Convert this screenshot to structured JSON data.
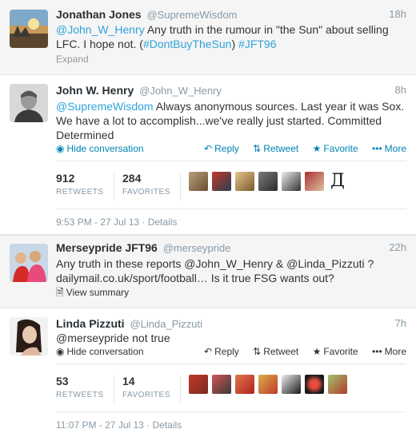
{
  "tweets": [
    {
      "fullname": "Jonathan Jones",
      "username": "@SupremeWisdom",
      "time": "18h",
      "text_parts": {
        "mention": "@John_W_Henry",
        "body1": " Any truth in the rumour in \"the Sun\" about selling LFC. I hope not. (",
        "hashtag1": "#DontBuyTheSun",
        "body2": ") ",
        "hashtag2": "#JFT96"
      },
      "expand": "Expand"
    },
    {
      "fullname": "John W. Henry",
      "username": "@John_W_Henry",
      "time": "8h",
      "text_parts": {
        "mention": "@SupremeWisdom",
        "body": " Always anonymous sources. Last year it was Sox. We have a lot to accomplish...we've really just started. Committed Determined"
      },
      "hide": "Hide conversation",
      "actions": {
        "reply": "Reply",
        "retweet": "Retweet",
        "favorite": "Favorite",
        "more": "More"
      },
      "stats": {
        "retweets": "912",
        "retweets_label": "RETWEETS",
        "favorites": "284",
        "favorites_label": "FAVORITES"
      },
      "meta": "9:53 PM - 27 Jul 13 · Details"
    },
    {
      "fullname": "Merseypride JFT96",
      "username": "@merseypride",
      "time": "22h",
      "text": "Any truth in these reports @John_W_Henry & @Linda_Pizzuti ? dailymail.co.uk/sport/football… Is it true FSG wants out?",
      "summary": "View summary"
    },
    {
      "fullname": "Linda Pizzuti",
      "username": "@Linda_Pizzuti",
      "time": "7h",
      "text": "@merseypride not true",
      "hide": "Hide conversation",
      "actions": {
        "reply": "Reply",
        "retweet": "Retweet",
        "favorite": "Favorite",
        "more": "More"
      },
      "stats": {
        "retweets": "53",
        "retweets_label": "RETWEETS",
        "favorites": "14",
        "favorites_label": "FAVORITES"
      },
      "meta": "11:07 PM - 27 Jul 13 · Details"
    }
  ],
  "favoriters_letter": "Д",
  "colors": {
    "link": "#2fa3d8",
    "action": "#0084b4",
    "muted": "#8899a6",
    "bg_expanded": "#f5f5f5"
  },
  "icons": {
    "speech": "speech-bubble-icon",
    "reply": "reply-arrow-icon",
    "retweet": "retweet-icon",
    "favorite": "star-icon",
    "more": "more-dots-icon",
    "document": "document-icon"
  }
}
